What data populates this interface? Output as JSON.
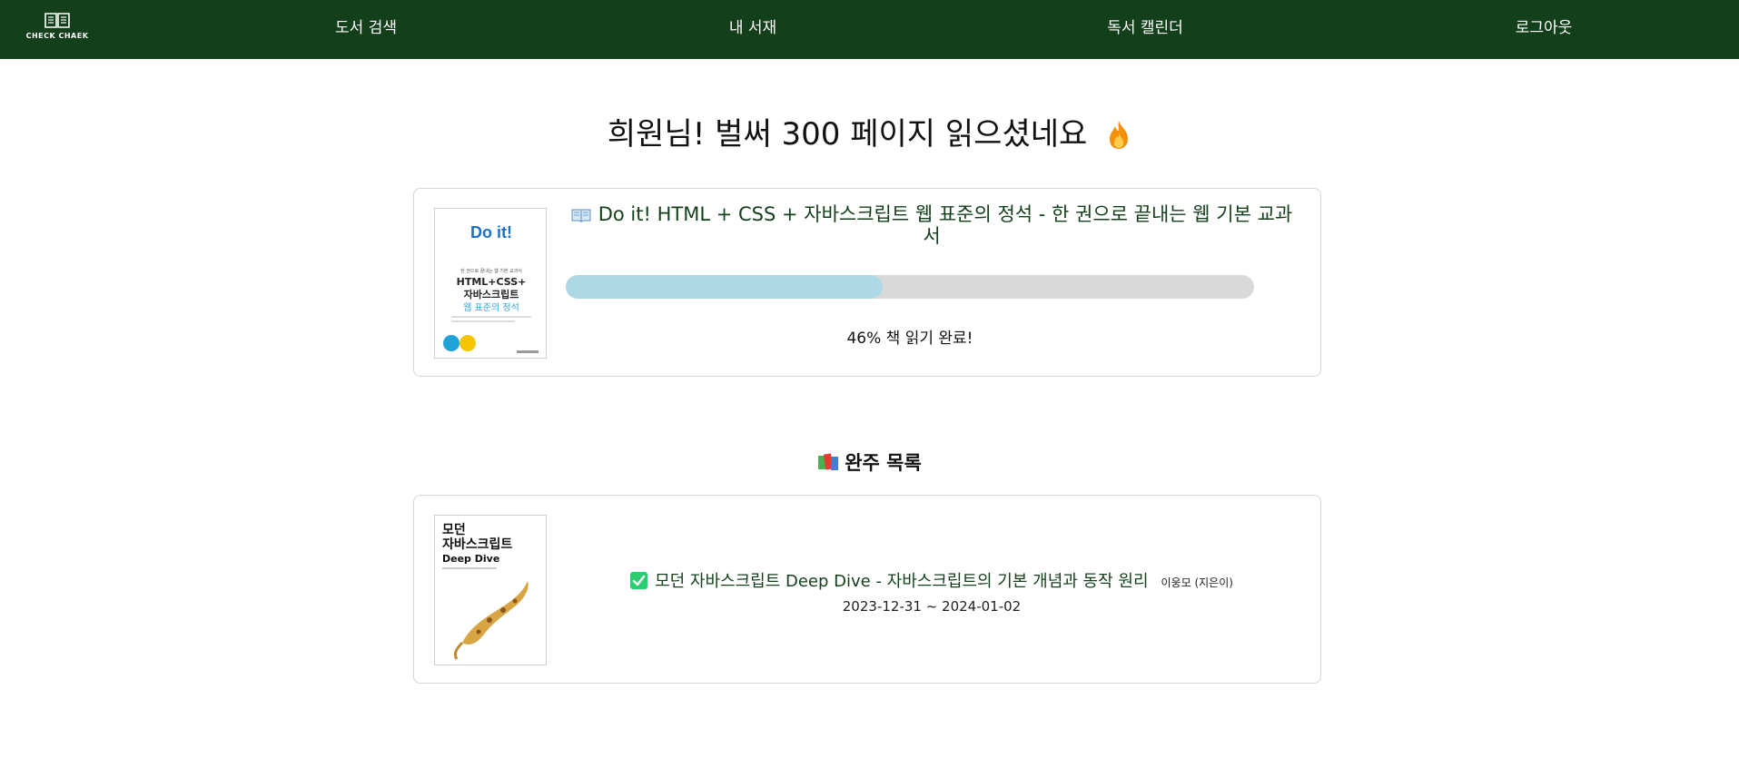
{
  "nav": {
    "logo_text": "CHECK CHAEK",
    "items": [
      "도서 검색",
      "내 서재",
      "독서 캘린더",
      "로그아웃"
    ]
  },
  "headline": {
    "text": "희원님! 벌써 300 페이지 읽으셨네요",
    "icon": "fire-icon"
  },
  "reading": {
    "title": "Do it! HTML + CSS + 자바스크립트 웹 표준의 정석 - 한 권으로 끝내는 웹 기본 교과서",
    "title_icon": "open-book-icon",
    "progress_percent": 46,
    "progress_text": "46% 책 읽기 완료!",
    "cover": {
      "brand": "Do it!",
      "tagline": "한 권으로 끝내는 웹 기본 교과서",
      "line1": "HTML+CSS+",
      "line2": "자바스크립트",
      "line3": "웹 표준의 정석"
    }
  },
  "completed": {
    "section_title": "완주 목록",
    "section_icon": "books-icon",
    "items": [
      {
        "title": "모던 자바스크립트 Deep Dive - 자바스크립트의 기본 개념과 동작 원리",
        "author": "이웅모 (지은이)",
        "dates": "2023-12-31 ~ 2024-01-02",
        "cover": {
          "line1": "모던",
          "line2": "자바스크립트",
          "line3": "Deep Dive"
        }
      }
    ]
  },
  "colors": {
    "nav_bg": "#133f1a",
    "progress_fill": "#add8e6",
    "progress_track": "#d9d9d9",
    "check_green": "#2ecc71"
  }
}
